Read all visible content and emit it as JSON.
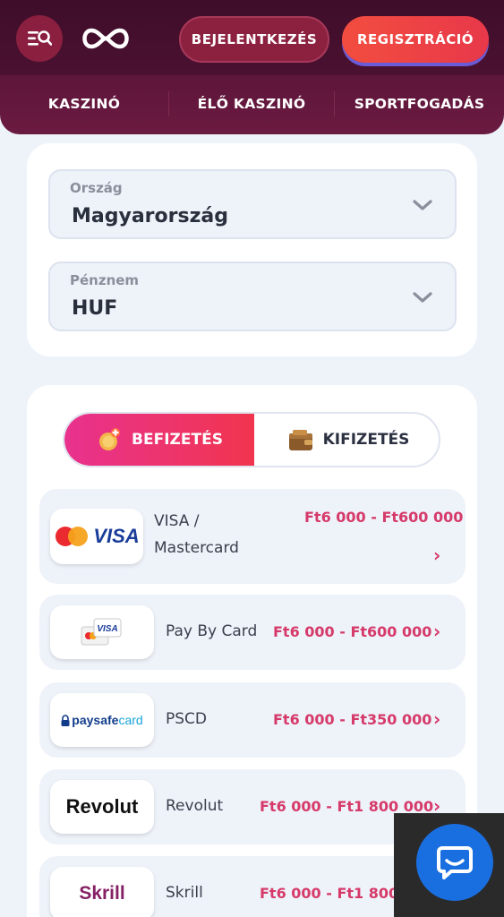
{
  "header": {
    "login_label": "BEJELENTKEZÉS",
    "register_label": "REGISZTRÁCIÓ"
  },
  "nav": {
    "items": [
      {
        "label": "KASZINÓ"
      },
      {
        "label": "ÉLŐ KASZINÓ"
      },
      {
        "label": "SPORTFOGADÁS"
      }
    ]
  },
  "filters": {
    "country_label": "Ország",
    "country_value": "Magyarország",
    "currency_label": "Pénznem",
    "currency_value": "HUF"
  },
  "tabs": {
    "deposit_label": "BEFIZETÉS",
    "withdraw_label": "KIFIZETÉS"
  },
  "payment_methods": [
    {
      "name_line1": "VISA /",
      "name_line2": "Mastercard",
      "range": "Ft6 000 - Ft600 000",
      "logo": "VISA"
    },
    {
      "name": "Pay By Card",
      "range": "Ft6 000 - Ft600 000",
      "logo": "VISA"
    },
    {
      "name": "PSCD",
      "range": "Ft6 000 - Ft350 000",
      "logo_a": "paysafe",
      "logo_b": "card"
    },
    {
      "name": "Revolut",
      "range": "Ft6 000 - Ft1 800 000",
      "logo": "Revolut"
    },
    {
      "name": "Skrill",
      "range": "Ft6 000 - Ft1 800 000",
      "logo": "Skrill"
    }
  ],
  "colors": {
    "header": "#4b1131",
    "accent": "#e8384a",
    "range": "#d63a6a",
    "chat": "#1a6fe0"
  }
}
